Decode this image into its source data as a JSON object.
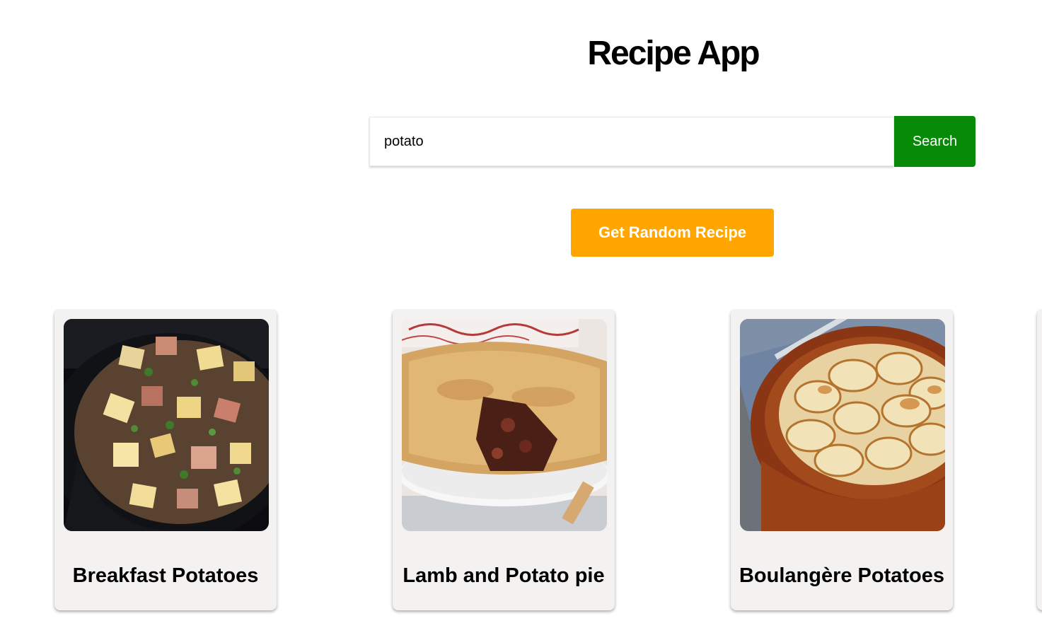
{
  "app": {
    "title": "Recipe App"
  },
  "search": {
    "value": "potato",
    "button_label": "Search"
  },
  "random": {
    "button_label": "Get Random Recipe"
  },
  "colors": {
    "search_button": "#068a08",
    "random_button": "#ffa600",
    "card_background": "#f4f1f1"
  },
  "recipes": [
    {
      "name": "Breakfast Potatoes",
      "image": "potato-hash-skillet-photo"
    },
    {
      "name": "Lamb and Potato pie",
      "image": "lamb-pie-photo"
    },
    {
      "name": "Boulangère Potatoes",
      "image": "boulangere-potatoes-photo"
    }
  ]
}
